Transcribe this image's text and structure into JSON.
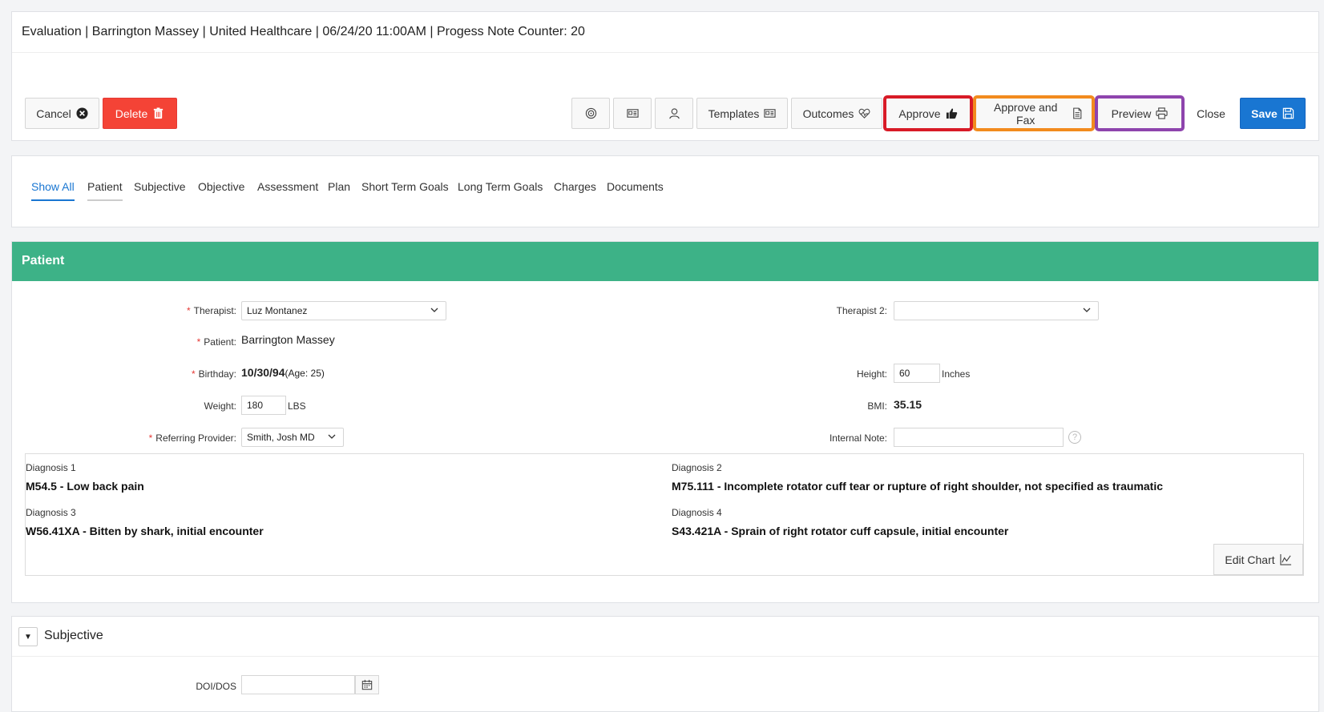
{
  "header": {
    "title": "Evaluation | Barrington Massey | United Healthcare | 06/24/20 11:00AM | Progess Note Counter: 20"
  },
  "toolbar": {
    "cancel": "Cancel",
    "delete": "Delete",
    "templates": "Templates",
    "outcomes": "Outcomes",
    "approve": "Approve",
    "approve_fax": "Approve and Fax",
    "preview": "Preview",
    "close": "Close",
    "save": "Save"
  },
  "tabs": [
    {
      "label": "Show All"
    },
    {
      "label": "Patient"
    },
    {
      "label": "Subjective"
    },
    {
      "label": "Objective"
    },
    {
      "label": "Assessment"
    },
    {
      "label": "Plan"
    },
    {
      "label": "Short Term Goals"
    },
    {
      "label": "Long Term Goals"
    },
    {
      "label": "Charges"
    },
    {
      "label": "Documents"
    }
  ],
  "patient_section": {
    "title": "Patient",
    "therapist_label": "Therapist:",
    "therapist_value": "Luz Montanez",
    "therapist2_label": "Therapist 2:",
    "therapist2_value": "",
    "patient_label": "Patient:",
    "patient_value": "Barrington Massey",
    "birthday_label": "Birthday:",
    "birthday_value": "10/30/94",
    "age_text": "(Age: 25)",
    "height_label": "Height:",
    "height_value": "60",
    "height_unit": "Inches",
    "weight_label": "Weight:",
    "weight_value": "180",
    "weight_unit": "LBS",
    "bmi_label": "BMI:",
    "bmi_value": "35.15",
    "referring_label": "Referring Provider:",
    "referring_value": "Smith, Josh MD",
    "internal_note_label": "Internal Note:",
    "internal_note_value": "",
    "help_glyph": "?"
  },
  "diagnoses": [
    {
      "label": "Diagnosis 1",
      "value": "M54.5 - Low back pain"
    },
    {
      "label": "Diagnosis 2",
      "value": "M75.111 - Incomplete rotator cuff tear or rupture of right shoulder, not specified as traumatic"
    },
    {
      "label": "Diagnosis 3",
      "value": "W56.41XA - Bitten by shark, initial encounter"
    },
    {
      "label": "Diagnosis 4",
      "value": "S43.421A - Sprain of right rotator cuff capsule, initial encounter"
    }
  ],
  "edit_chart": "Edit Chart",
  "subjective": {
    "title": "Subjective",
    "toggle_glyph": "▼",
    "doi_label": "DOI/DOS",
    "doi_value": ""
  },
  "colors": {
    "section_header": "#3db287",
    "delete": "#f44336",
    "save": "#1976d2",
    "approve_outline": "#d81b27",
    "approve_fax_outline": "#f28b1e",
    "preview_outline": "#8e44ad"
  }
}
